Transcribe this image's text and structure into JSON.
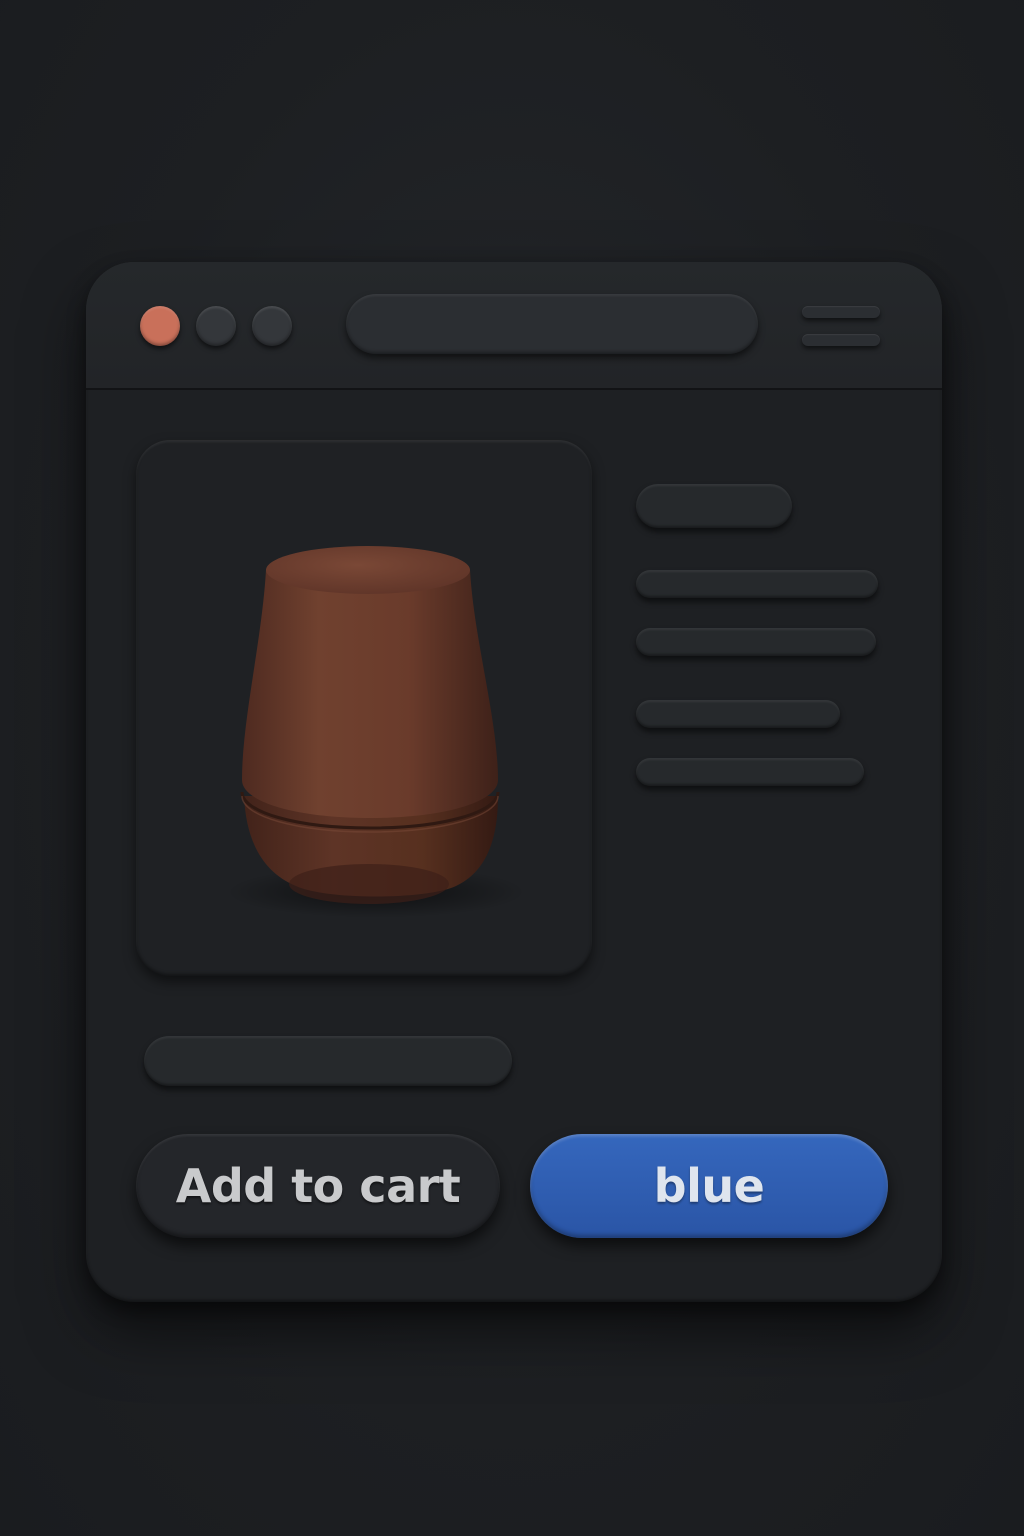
{
  "window": {
    "controls": [
      {
        "name": "close",
        "color": "#c9705a"
      },
      {
        "name": "minimize",
        "color": "#34373b"
      },
      {
        "name": "maximize",
        "color": "#34373b"
      }
    ]
  },
  "product": {
    "image_icon": "brown-cylindrical-smart-speaker",
    "product_color": "#6a3a2c"
  },
  "actions": {
    "add_to_cart_label": "Add to cart",
    "blue_label": "blue"
  },
  "colors": {
    "accent_blue": "#2f5fb3",
    "background": "#1d1f22",
    "window": "#1e2023"
  }
}
